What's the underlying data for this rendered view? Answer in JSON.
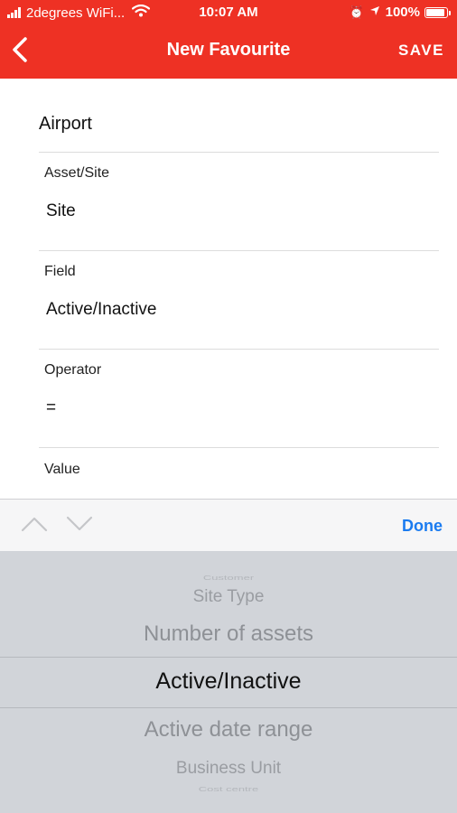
{
  "status_bar": {
    "carrier": "2degrees WiFi...",
    "time": "10:07 AM",
    "battery": "100%",
    "battery_level": 1.0
  },
  "nav": {
    "title": "New Favourite",
    "save_label": "SAVE",
    "back_icon": "chevron-left-icon"
  },
  "form": {
    "name_value": "Airport",
    "asset_site": {
      "label": "Asset/Site",
      "value": "Site"
    },
    "field": {
      "label": "Field",
      "value": "Active/Inactive"
    },
    "operator": {
      "label": "Operator",
      "value": "="
    },
    "value": {
      "label": "Value"
    }
  },
  "accessory": {
    "done_label": "Done"
  },
  "picker": {
    "items": [
      "Customer",
      "Site Type",
      "Number of assets",
      "Active/Inactive",
      "Active date range",
      "Business Unit",
      "Cost centre"
    ],
    "selected": "Active/Inactive"
  },
  "colors": {
    "brand_red": "#ee3124",
    "done_blue": "#1a7bf0",
    "picker_bg": "#d1d4d9"
  }
}
